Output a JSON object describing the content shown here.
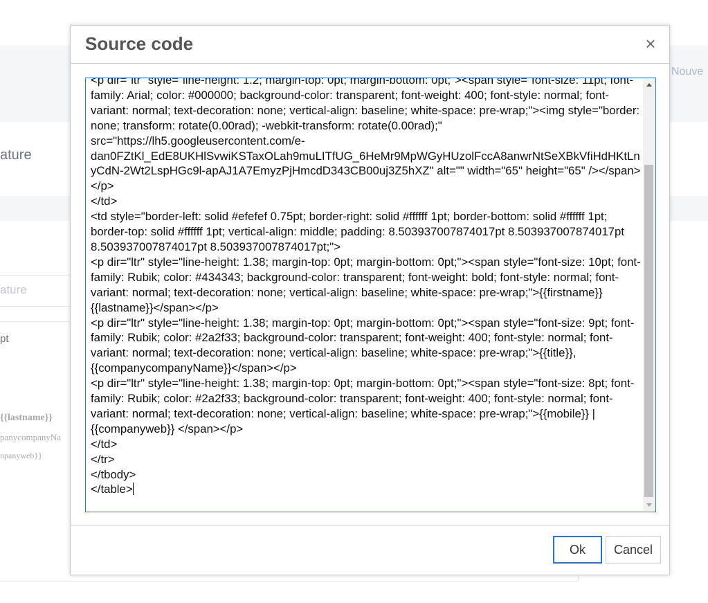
{
  "background": {
    "header_link": "Nouve",
    "title_fragment": "ature",
    "field_placeholder_fragment": "ature",
    "unit_fragment": "pt",
    "signature_lines": [
      "{{lastname}}",
      "panycompanyNa",
      "npanyweb}}"
    ]
  },
  "modal": {
    "title": "Source code",
    "close_glyph": "×",
    "code": "<p dir=\"ltr\" style=\"line-height: 1.2; margin-top: 0pt; margin-bottom: 0pt;\"><span style=\"font-size: 11pt; font-family: Arial; color: #000000; background-color: transparent; font-weight: 400; font-style: normal; font-variant: normal; text-decoration: none; vertical-align: baseline; white-space: pre-wrap;\"><img style=\"border: none; transform: rotate(0.00rad); -webkit-transform: rotate(0.00rad);\" src=\"https://lh5.googleusercontent.com/e-dan0FZtKl_EdE8UKHlSvwiKSTaxOLah9muLITfUG_6HeMr9MpWGyHUzolFccA8anwrNtSeXBkVfiHdHKtLnyCdN-2Wt2LspHGc9l-apAJ1A7EmyzPjHmcdD343CB00uj3Z5hXZ\" alt=\"\" width=\"65\" height=\"65\" /></span></p>\n</td>\n<td style=\"border-left: solid #efefef 0.75pt; border-right: solid #ffffff 1pt; border-bottom: solid #ffffff 1pt; border-top: solid #ffffff 1pt; vertical-align: middle; padding: 8.503937007874017pt 8.503937007874017pt 8.503937007874017pt 8.503937007874017pt;\">\n<p dir=\"ltr\" style=\"line-height: 1.38; margin-top: 0pt; margin-bottom: 0pt;\"><span style=\"font-size: 10pt; font-family: Rubik; color: #434343; background-color: transparent; font-weight: bold; font-style: normal; font-variant: normal; text-decoration: none; vertical-align: baseline; white-space: pre-wrap;\">{{firstname}} {{lastname}}</span></p>\n<p dir=\"ltr\" style=\"line-height: 1.38; margin-top: 0pt; margin-bottom: 0pt;\"><span style=\"font-size: 9pt; font-family: Rubik; color: #2a2f33; background-color: transparent; font-weight: 400; font-style: normal; font-variant: normal; text-decoration: none; vertical-align: baseline; white-space: pre-wrap;\">{{title}}, {{companycompanyName}}</span></p>\n<p dir=\"ltr\" style=\"line-height: 1.38; margin-top: 0pt; margin-bottom: 0pt;\"><span style=\"font-size: 8pt; font-family: Rubik; color: #2a2f33; background-color: transparent; font-weight: 400; font-style: normal; font-variant: normal; text-decoration: none; vertical-align: baseline; white-space: pre-wrap;\">{{mobile}} | {{companyweb}} </span></p>\n</td>\n</tr>\n</tbody>\n</table>",
    "ok_label": "Ok",
    "cancel_label": "Cancel"
  },
  "colors": {
    "accent": "#2276d2",
    "modal_title": "#555555",
    "background_band": "#f4f6f8"
  }
}
